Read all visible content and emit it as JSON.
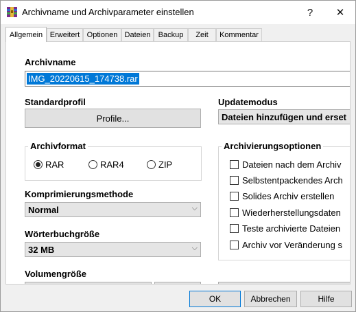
{
  "window": {
    "title": "Archivname und Archivparameter einstellen",
    "help_glyph": "?",
    "close_glyph": "✕"
  },
  "tabs": [
    {
      "label": "Allgemein",
      "active": true
    },
    {
      "label": "Erweitert",
      "active": false
    },
    {
      "label": "Optionen",
      "active": false
    },
    {
      "label": "Dateien",
      "active": false
    },
    {
      "label": "Backup",
      "active": false
    },
    {
      "label": "Zeit",
      "active": false
    },
    {
      "label": "Kommentar",
      "active": false
    }
  ],
  "general": {
    "archive_name_label": "Archivname",
    "archive_name_value": "IMG_20220615_174738.rar",
    "default_profile_label": "Standardprofil",
    "profiles_button": "Profile...",
    "update_mode_label": "Updatemodus",
    "update_mode_value": "Dateien hinzufügen und erset",
    "archive_format_label": "Archivformat",
    "formats": [
      {
        "label": "RAR",
        "selected": true
      },
      {
        "label": "RAR4",
        "selected": false
      },
      {
        "label": "ZIP",
        "selected": false
      }
    ],
    "compression_label": "Komprimierungsmethode",
    "compression_value": "Normal",
    "dictionary_label": "Wörterbuchgröße",
    "dictionary_value": "32 MB",
    "volume_label": "Volumengröße",
    "archiving_options_label": "Archivierungsoptionen",
    "archiving_options": [
      {
        "label": "Dateien nach dem Archiv",
        "checked": false
      },
      {
        "label": "Selbstentpackendes Arch",
        "checked": false
      },
      {
        "label": "Solides Archiv erstellen",
        "checked": false
      },
      {
        "label": "Wiederherstellungsdaten",
        "checked": false
      },
      {
        "label": "Teste archivierte Dateien",
        "checked": false
      },
      {
        "label": "Archiv vor Veränderung s",
        "checked": false
      }
    ],
    "dropdown_arrow": "⌵"
  },
  "buttons": {
    "ok": "OK",
    "cancel": "Abbrechen",
    "help": "Hilfe"
  },
  "colors": {
    "selection": "#0078d7",
    "accent_border": "#0078d7"
  }
}
